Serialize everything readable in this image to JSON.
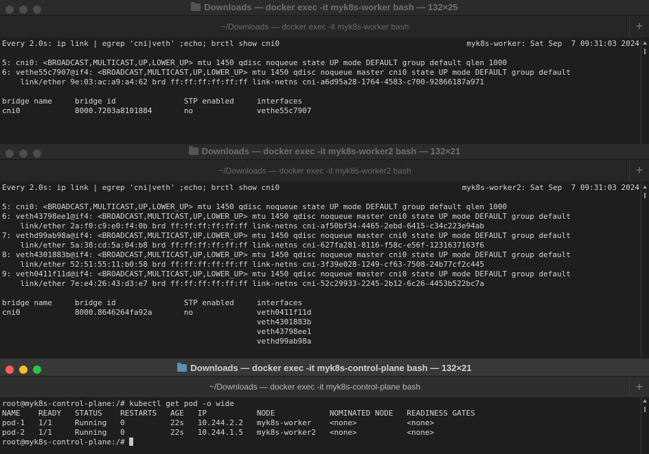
{
  "windows": [
    {
      "title": "Downloads — docker exec -it myk8s-worker bash — 132×25",
      "tab": "~/Downloads — docker exec -it myk8s-worker bash",
      "header_left": "Every 2.0s: ip link | egrep 'cni|veth' ;echo; brctl show cni0",
      "header_right": "myk8s-worker: Sat Sep  7 09:31:03 2024",
      "body": "\n5: cni0: <BROADCAST,MULTICAST,UP,LOWER_UP> mtu 1450 qdisc noqueue state UP mode DEFAULT group default qlen 1000\n6: vethe55c7907@if4: <BROADCAST,MULTICAST,UP,LOWER_UP> mtu 1450 qdisc noqueue master cni0 state UP mode DEFAULT group default\n    link/ether 9e:03:ac:a9:a4:62 brd ff:ff:ff:ff:ff:ff link-netns cni-a6d95a28-1764-4583-c700-92866187a971\n\nbridge name     bridge id               STP enabled     interfaces\ncni0            8000.7203a8101884       no              vethe55c7907"
    },
    {
      "title": "Downloads — docker exec -it myk8s-worker2 bash — 132×21",
      "tab": "~/Downloads — docker exec -it myk8s-worker2 bash",
      "header_left": "Every 2.0s: ip link | egrep 'cni|veth' ;echo; brctl show cni0",
      "header_right": "myk8s-worker2: Sat Sep  7 09:31:03 2024",
      "body": "\n5: cni0: <BROADCAST,MULTICAST,UP,LOWER_UP> mtu 1450 qdisc noqueue state UP mode DEFAULT group default qlen 1000\n6: veth43798ee1@if4: <BROADCAST,MULTICAST,UP,LOWER_UP> mtu 1450 qdisc noqueue master cni0 state UP mode DEFAULT group default\n    link/ether 2a:f0:c9:e0:f4:0b brd ff:ff:ff:ff:ff:ff link-netns cni-af50bf34-4465-2ebd-6415-c34c223e94ab\n7: vethd99ab98a@if4: <BROADCAST,MULTICAST,UP,LOWER_UP> mtu 1450 qdisc noqueue master cni0 state UP mode DEFAULT group default\n    link/ether 5a:38:cd:5a:04:b8 brd ff:ff:ff:ff:ff:ff link-netns cni-627fa281-8116-f58c-e56f-1231637163f6\n8: veth4301883b@if4: <BROADCAST,MULTICAST,UP,LOWER_UP> mtu 1450 qdisc noqueue master cni0 state UP mode DEFAULT group default\n    link/ether 52:51:55:11:b0:58 brd ff:ff:ff:ff:ff:ff link-netns cni-3f39e028-1249-cf63-7508-24b77cf2c445\n9: veth0411f11d@if4: <BROADCAST,MULTICAST,UP,LOWER_UP> mtu 1450 qdisc noqueue master cni0 state UP mode DEFAULT group default\n    link/ether 7e:e4:26:43:d3:e7 brd ff:ff:ff:ff:ff:ff link-netns cni-52c29933-2245-2b12-6c26-4453b522bc7a\n\nbridge name     bridge id               STP enabled     interfaces\ncni0            8000.8646264fa92a       no              veth0411f11d\n                                                        veth4301883b\n                                                        veth43798ee1\n                                                        vethd99ab98a"
    },
    {
      "title": "Downloads — docker exec -it myk8s-control-plane bash — 132×21",
      "tab": "~/Downloads — docker exec -it myk8s-control-plane bash",
      "body": "root@myk8s-control-plane:/# kubectl get pod -o wide\nNAME    READY   STATUS    RESTARTS   AGE   IP           NODE            NOMINATED NODE   READINESS GATES\npod-1   1/1     Running   0          22s   10.244.2.2   myk8s-worker    <none>           <none>\npod-2   1/1     Running   0          22s   10.244.1.5   myk8s-worker2   <none>           <none>",
      "prompt": "root@myk8s-control-plane:/# "
    }
  ],
  "icons": {
    "new_tab": "+",
    "folder": "folder-icon"
  }
}
